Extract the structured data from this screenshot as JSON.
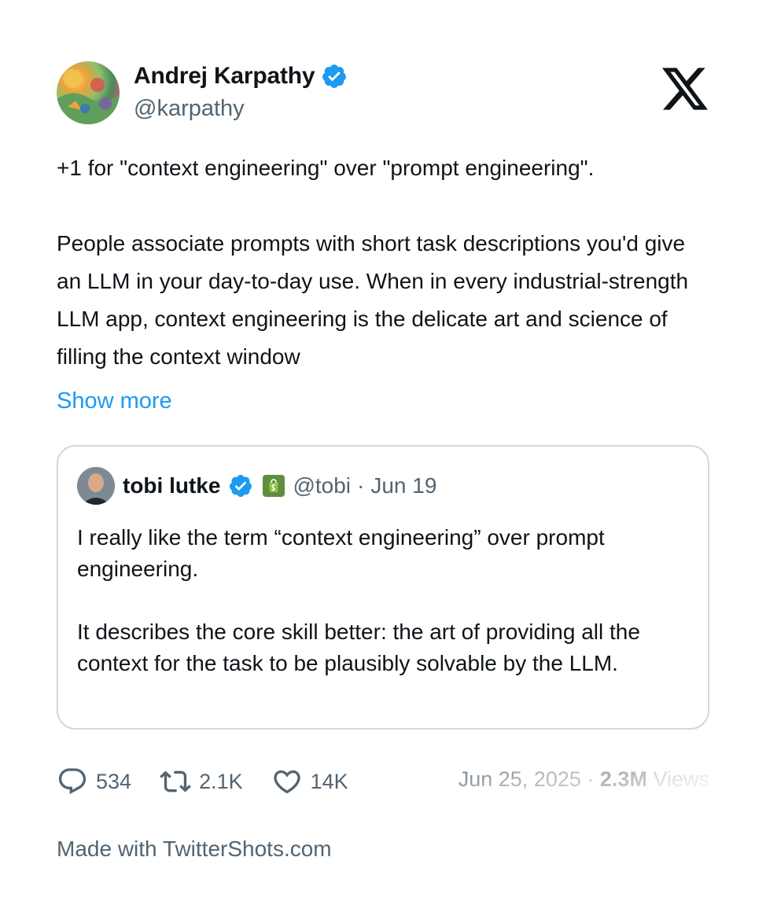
{
  "author": {
    "name": "Andrej Karpathy",
    "handle": "@karpathy"
  },
  "tweet": {
    "paragraphs": [
      "+1 for \"context engineering\" over \"prompt engineering\".",
      "People associate prompts with short task descriptions you'd give an LLM in your day-to-day use. When in every industrial-strength LLM app, context engineering is the delicate art and science of filling the context window"
    ],
    "show_more": "Show more"
  },
  "quote": {
    "name": "tobi lutke",
    "handle": "@tobi",
    "separator": "·",
    "date": "Jun 19",
    "paragraphs": [
      "I really like the term “context engineering” over prompt engineering.",
      "It describes the core skill better: the art of providing all the context for the task to be plausibly solvable by the LLM."
    ]
  },
  "metrics": {
    "replies": "534",
    "retweets": "2.1K",
    "likes": "14K",
    "date": "Jun 25, 2025",
    "separator": "·",
    "views": "2.3M",
    "views_label": "Views"
  },
  "footer": {
    "made_with": "Made with TwitterShots.com"
  },
  "colors": {
    "accent": "#1d9bf0",
    "text": "#0f1419",
    "muted": "#536471",
    "border": "#cfd9de"
  },
  "icons": [
    "verified-badge-icon",
    "x-logo-icon",
    "shopify-icon",
    "reply-icon",
    "retweet-icon",
    "like-icon"
  ]
}
